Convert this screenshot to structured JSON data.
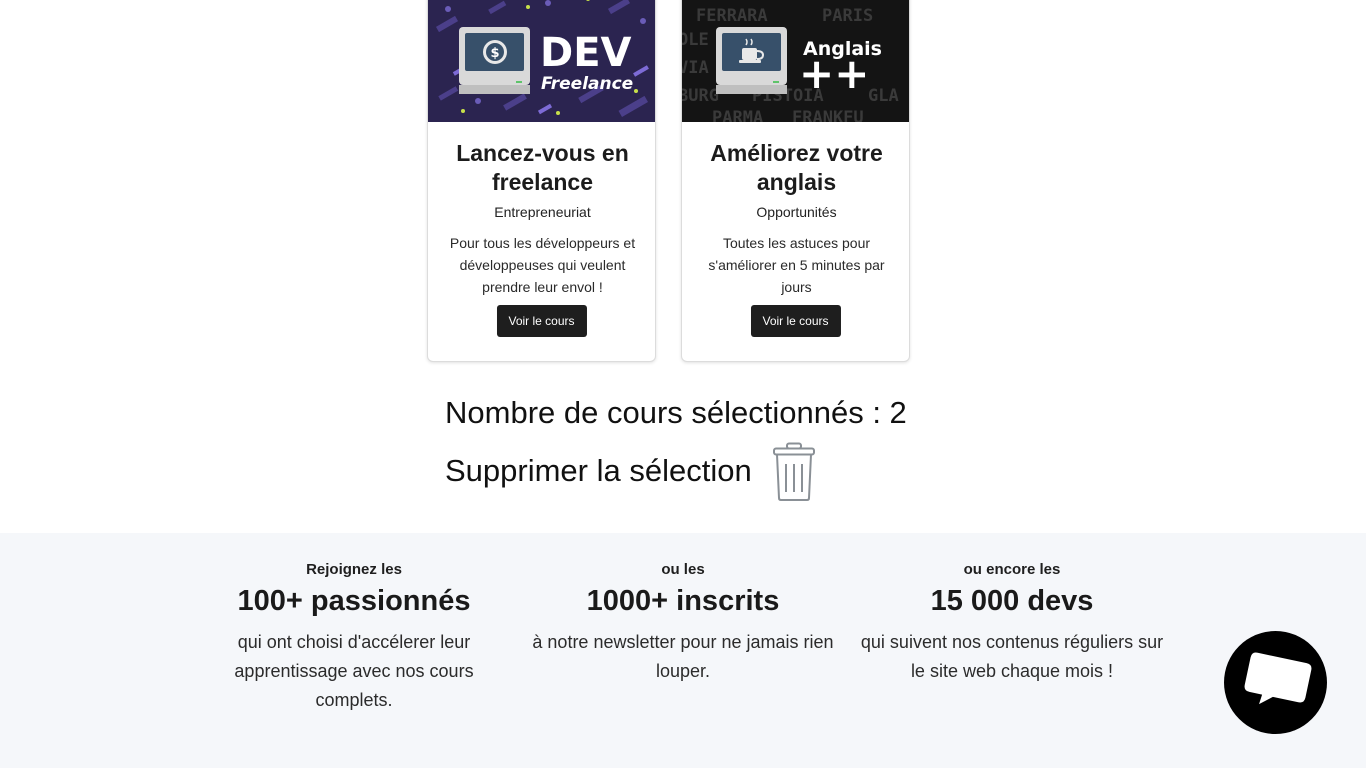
{
  "courses": [
    {
      "image_title": "DEV",
      "image_subtitle": "Freelance",
      "title": "Lancez-vous en freelance",
      "category": "Entrepreneuriat",
      "description": "Pour tous les développeurs et développeuses qui veulent prendre leur envol !",
      "button_label": "Voir le cours",
      "icon": "dollar-coin-monitor-icon"
    },
    {
      "image_title": "Anglais",
      "image_subtitle": "++",
      "image_bg_words": [
        "FERRARA",
        "PARIS",
        "OLE",
        "VIA",
        "BURG",
        "PISTOIA",
        "GLA",
        "PARMA",
        "FRANKFU"
      ],
      "title": "Améliorez votre anglais",
      "category": "Opportunités",
      "description": "Toutes les astuces pour s'améliorer en 5 minutes par jours",
      "button_label": "Voir le cours",
      "icon": "coffee-cup-monitor-icon"
    }
  ],
  "selection": {
    "count_text": "Nombre de cours sélectionnés : 2",
    "delete_label": "Supprimer la sélection",
    "delete_icon": "trash-icon"
  },
  "stats": [
    {
      "pre": "Rejoignez les",
      "big": "100+ passionnés",
      "desc": "qui ont choisi d'accélerer leur apprentissage avec nos cours complets."
    },
    {
      "pre": "ou les",
      "big": "1000+ inscrits",
      "desc": "à notre newsletter pour ne jamais rien louper."
    },
    {
      "pre": "ou encore les",
      "big": "15 000 devs",
      "desc": "qui suivent nos contenus réguliers sur le site web chaque mois !"
    }
  ],
  "chat": {
    "icon": "chat-bubble-icon"
  },
  "colors": {
    "card_image_bg_1": "#2b2450",
    "card_image_bg_2": "#141414",
    "button_bg": "#1e1e1e",
    "stats_bg": "#f5f7fa"
  }
}
